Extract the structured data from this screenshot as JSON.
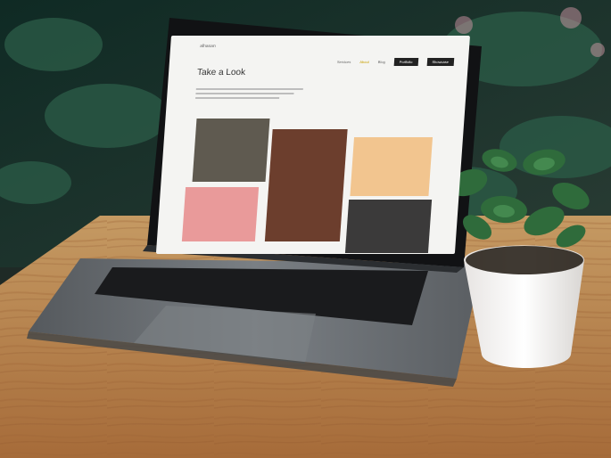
{
  "screen": {
    "brand": "alhasan",
    "nav": {
      "link_1": "Services",
      "link_2": "About",
      "link_3": "Blog",
      "button_1": "Portfolio",
      "button_2": "Showcase"
    },
    "title": "Take a Look"
  },
  "colors": {
    "wood": "#b37a45",
    "laptop_body": "#6f7377",
    "keyboard": "#1a1b1d",
    "pot": "#f2f0ee",
    "plant": "#2f6b3b",
    "foliage_bg": "#1a3a2a"
  }
}
